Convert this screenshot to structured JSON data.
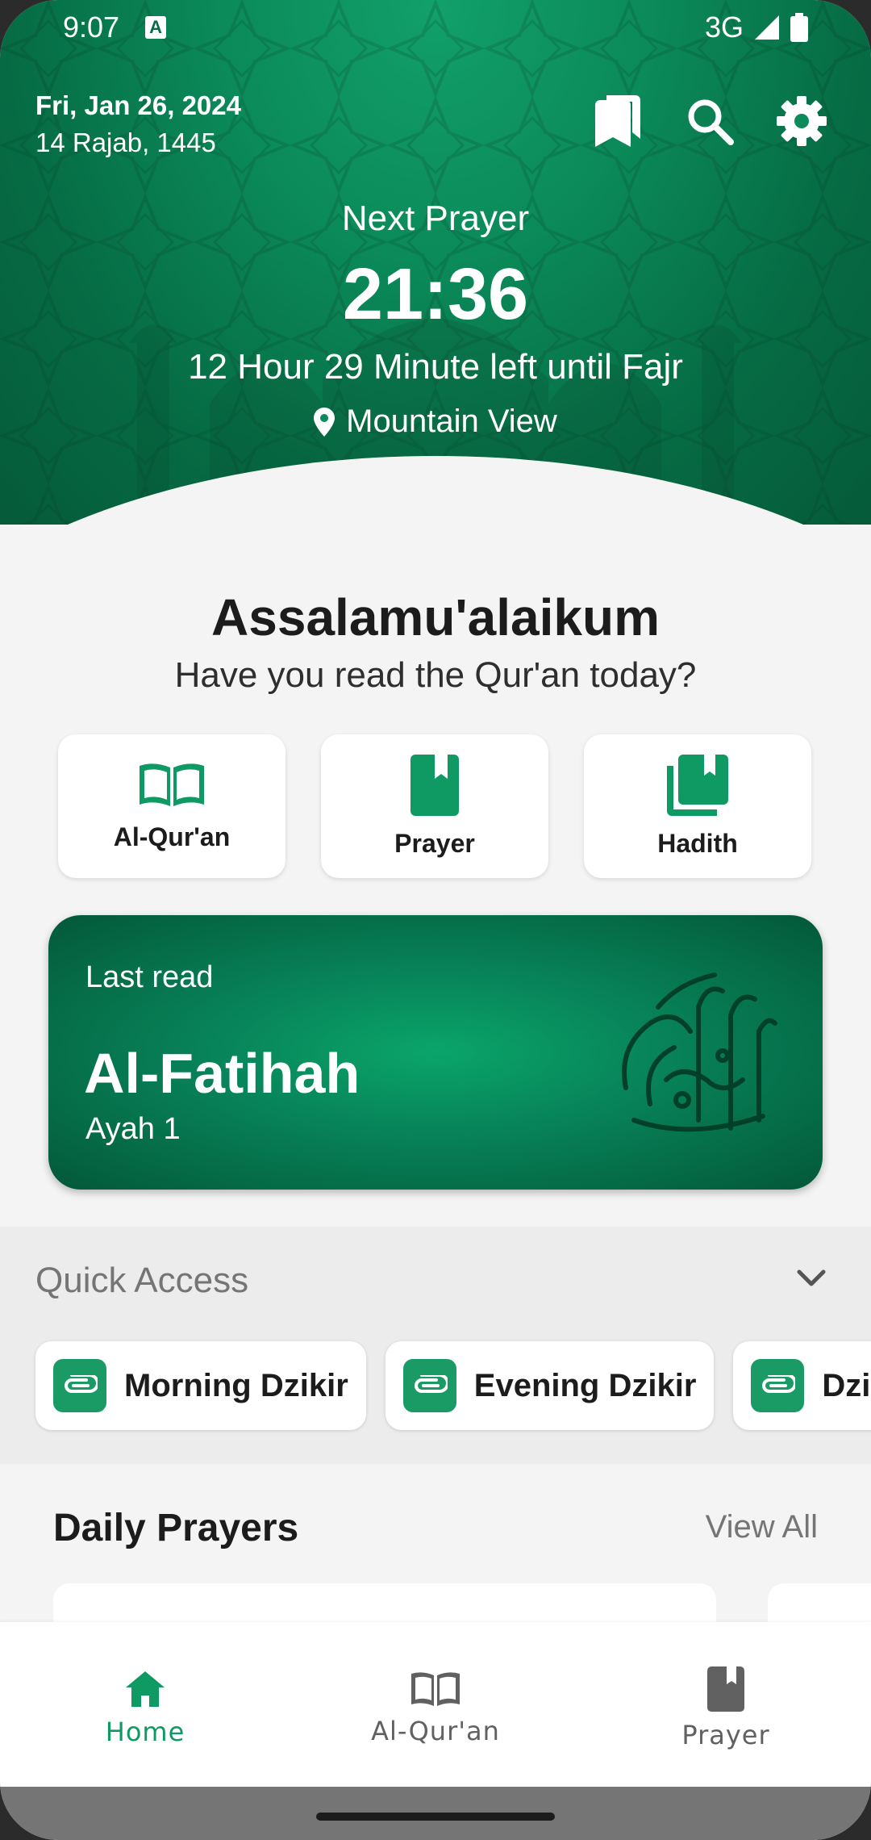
{
  "status_bar": {
    "time": "9:07",
    "notification_badge": "A",
    "network": "3G"
  },
  "header": {
    "date": "Fri, Jan 26, 2024",
    "hijri_date": "14 Rajab, 1445",
    "next_prayer_label": "Next Prayer",
    "next_prayer_time": "21:36",
    "time_left": "12 Hour 29 Minute left until Fajr",
    "location": "Mountain View"
  },
  "greeting": {
    "title": "Assalamu'alaikum",
    "subtitle": "Have you read the Qur'an today?"
  },
  "menu": [
    {
      "label": "Al-Qur'an",
      "icon": "open-book-icon"
    },
    {
      "label": "Prayer",
      "icon": "bookmark-book-icon"
    },
    {
      "label": "Hadith",
      "icon": "books-stack-icon"
    }
  ],
  "last_read": {
    "label": "Last read",
    "surah": "Al-Fatihah",
    "ayah": "Ayah 1"
  },
  "quick_access": {
    "title": "Quick Access",
    "items": [
      "Morning Dzikir",
      "Evening Dzikir",
      "Dzikir A"
    ]
  },
  "daily_prayers": {
    "title": "Daily Prayers",
    "view_all": "View All"
  },
  "bottom_nav": [
    {
      "label": "Home",
      "active": true
    },
    {
      "label": "Al-Qur'an",
      "active": false
    },
    {
      "label": "Prayer",
      "active": false
    }
  ],
  "colors": {
    "primary": "#0b8a5a",
    "accent": "#1a9a64",
    "inactive": "#757575"
  }
}
